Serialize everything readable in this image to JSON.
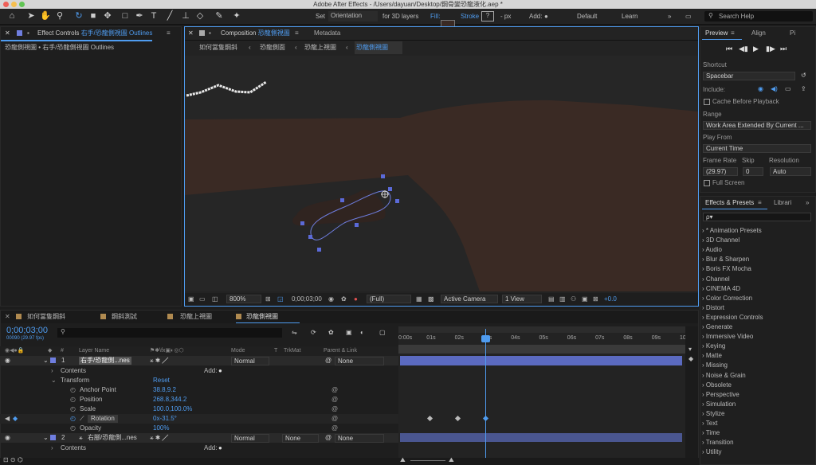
{
  "app": {
    "title": "Adobe After Effects - /Users/dayuan/Desktop/鋼骨變恐龍液化.aep *"
  },
  "toolbar": {
    "set_label": "Set",
    "orientation": "Orientation",
    "for3d": "for 3D layers",
    "fill_label": "Fill:",
    "stroke_label": "Stroke",
    "stroke_value": "?",
    "px_label": "- px",
    "add_label": "Add:",
    "workspace_default": "Default",
    "workspace_learn": "Learn",
    "search_placeholder": "Search Help"
  },
  "effect_controls": {
    "tab": "Effect Controls",
    "tab_target": "右手/恐龍側視圖 Outlines",
    "subtitle": "恐龍側視圖 • 右手/恐龍側視圖 Outlines"
  },
  "composition": {
    "tab_prefix": "Composition",
    "tab_name": "恐龍側視圖",
    "metadata_tab": "Metadata",
    "breadcrumbs": [
      "如何當隻鋼斜",
      "恐龍側面",
      "恐龍上視圖",
      "恐龍側視圖"
    ],
    "zoom": "800%",
    "timecode": "0;00;03;00",
    "resolution": "(Full)",
    "camera": "Active Camera",
    "views": "1 View",
    "exposure": "+0.0"
  },
  "preview": {
    "tab": "Preview",
    "align_tab": "Align",
    "shortcut_label": "Shortcut",
    "shortcut_value": "Spacebar",
    "include_label": "Include:",
    "cache_label": "Cache Before Playback",
    "range_label": "Range",
    "range_value": "Work Area Extended By Current ...",
    "playfrom_label": "Play From",
    "playfrom_value": "Current Time",
    "framerate_label": "Frame Rate",
    "skip_label": "Skip",
    "resolution_label": "Resolution",
    "framerate_value": "(29.97)",
    "skip_value": "0",
    "resolution_value": "Auto",
    "fullscreen_label": "Full Screen"
  },
  "effects": {
    "tab": "Effects & Presets",
    "libraries_tab": "Librari",
    "search_placeholder": "ρ▾",
    "items": [
      "* Animation Presets",
      "3D Channel",
      "Audio",
      "Blur & Sharpen",
      "Boris FX Mocha",
      "Channel",
      "CINEMA 4D",
      "Color Correction",
      "Distort",
      "Expression Controls",
      "Generate",
      "Immersive Video",
      "Keying",
      "Matte",
      "Missing",
      "Noise & Grain",
      "Obsolete",
      "Perspective",
      "Simulation",
      "Stylize",
      "Text",
      "Time",
      "Transition",
      "Utility"
    ]
  },
  "timeline": {
    "tabs": [
      "如何當隻鋼斜",
      "鋼斜測試",
      "恐龍上視圖",
      "恐龍側視圖"
    ],
    "timecode": "0;00;03;00",
    "fps_note": "00090 (29.97 fps)",
    "col_layer_name": "Layer Name",
    "col_mode": "Mode",
    "col_t": "T",
    "col_trkmat": "TrkMat",
    "col_parent": "Parent & Link",
    "ticks": [
      "0:00s",
      "01s",
      "02s",
      "03s",
      "04s",
      "05s",
      "06s",
      "07s",
      "08s",
      "09s",
      "10s"
    ],
    "layer1": {
      "num": "1",
      "name": "右手/恐龍側...nes",
      "mode": "Normal",
      "parent": "None"
    },
    "contents_label": "Contents",
    "add_label": "Add:",
    "transform_label": "Transform",
    "reset_label": "Reset",
    "props": [
      {
        "name": "Anchor Point",
        "value": "38.8,9.2"
      },
      {
        "name": "Position",
        "value": "268.8,344.2"
      },
      {
        "name": "Scale",
        "value": "100.0,100.0%"
      },
      {
        "name": "Rotation",
        "value": "0x-31.5°"
      },
      {
        "name": "Opacity",
        "value": "100%"
      }
    ],
    "layer2": {
      "num": "2",
      "name": "右腳/恐龍側...nes",
      "mode": "Normal",
      "trkmat": "None",
      "parent": "None"
    }
  },
  "colors": {
    "accent": "#4f9cf0",
    "label": "#6f7ee0",
    "bg_brown": "#3a2a24",
    "viewer_bg": "#262626"
  }
}
